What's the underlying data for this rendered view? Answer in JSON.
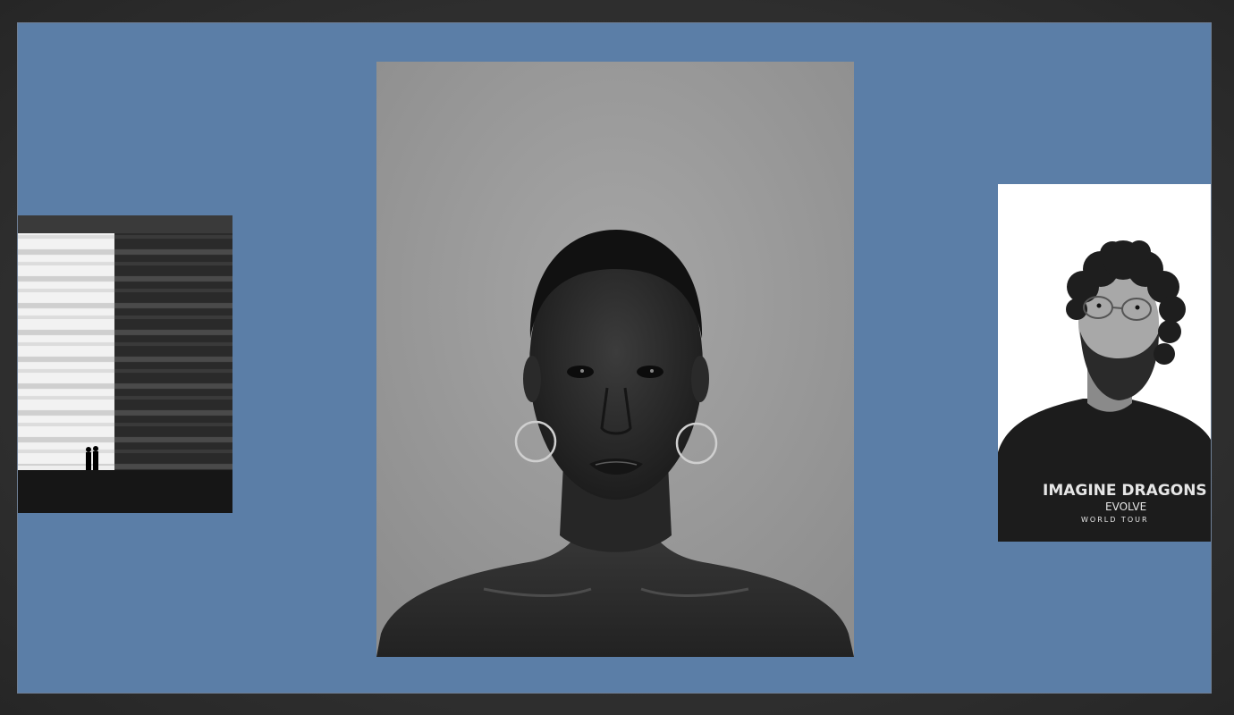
{
  "canvas": {
    "background_color": "#5b7ea7",
    "frame_color": "#2b2b2b"
  },
  "photos": [
    {
      "subject": "building-facade-silhouettes",
      "style": "black-and-white"
    },
    {
      "subject": "woman-portrait-hoop-earrings",
      "style": "black-and-white"
    },
    {
      "subject": "man-curly-hair-glasses-band-tshirt",
      "style": "black-and-white",
      "shirt_text": {
        "line1": "IMAGINE DRAGONS",
        "line2": "EVOLVE",
        "line3": "WORLD TOUR"
      }
    }
  ]
}
